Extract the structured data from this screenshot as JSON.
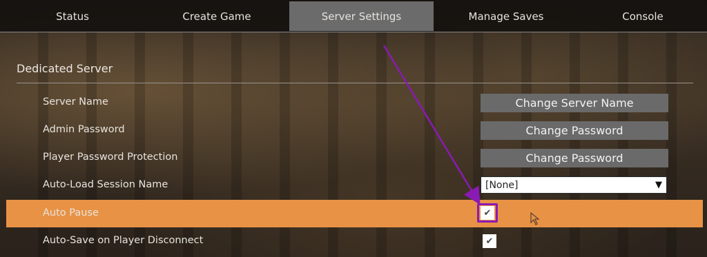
{
  "tabs": [
    {
      "label": "Status"
    },
    {
      "label": "Create Game"
    },
    {
      "label": "Server Settings"
    },
    {
      "label": "Manage Saves"
    },
    {
      "label": "Console"
    }
  ],
  "active_tab": "Server Settings",
  "section": {
    "title": "Dedicated Server"
  },
  "rows": {
    "server_name": {
      "label": "Server Name",
      "button": "Change Server Name"
    },
    "admin_password": {
      "label": "Admin Password",
      "button": "Change Password"
    },
    "player_password": {
      "label": "Player Password Protection",
      "button": "Change Password"
    },
    "auto_load": {
      "label": "Auto-Load Session Name",
      "value": "[None]",
      "arrow": "▼"
    },
    "auto_pause": {
      "label": "Auto Pause",
      "checked": true,
      "mark": "✔"
    },
    "auto_save": {
      "label": "Auto-Save on Player Disconnect",
      "checked": true,
      "mark": "✔"
    }
  },
  "colors": {
    "highlight_row": "#e89245",
    "annotation_arrow": "#8a1ab4",
    "active_tab": "#6b6b6b",
    "button": "#6a6a6a"
  },
  "icons": {
    "checkbox": "check-icon",
    "dropdown": "triangle-down-icon",
    "annotation": "arrow-annotation",
    "pointer": "mouse-cursor-icon"
  }
}
